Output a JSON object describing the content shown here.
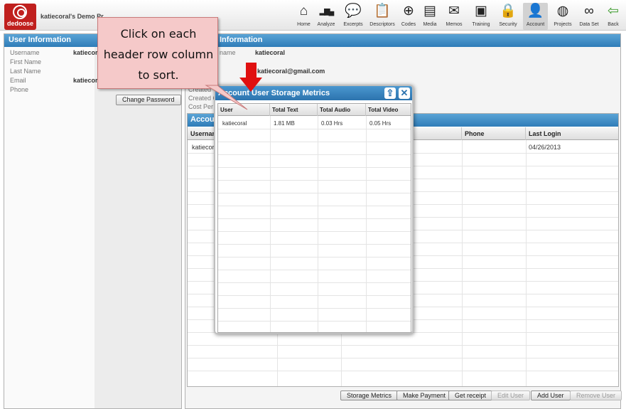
{
  "app": {
    "logo_text": "dedoose",
    "project_name": "katiecoral's Demo Pr"
  },
  "nav": [
    {
      "label": "Home",
      "icon": "home-icon",
      "glyph": "⌂"
    },
    {
      "label": "Analyze",
      "icon": "bar-chart-icon",
      "glyph": "▂▆▄"
    },
    {
      "label": "Excerpts",
      "icon": "speech-bubble-icon",
      "glyph": "💬"
    },
    {
      "label": "Descriptors",
      "icon": "clipboard-icon",
      "glyph": "📋"
    },
    {
      "label": "Codes",
      "icon": "plus-circle-icon",
      "glyph": "⊕"
    },
    {
      "label": "Media",
      "icon": "document-icon",
      "glyph": "▤"
    },
    {
      "label": "Memos",
      "icon": "scroll-icon",
      "glyph": "✉"
    },
    {
      "label": "Training",
      "icon": "training-icon",
      "glyph": "▣"
    },
    {
      "label": "Security",
      "icon": "lock-icon",
      "glyph": "🔒"
    },
    {
      "label": "Account",
      "icon": "person-icon",
      "glyph": "👤"
    },
    {
      "label": "Projects",
      "icon": "globe-icon",
      "glyph": "◍"
    },
    {
      "label": "Data Set",
      "icon": "binoculars-icon",
      "glyph": "∞"
    },
    {
      "label": "Back",
      "icon": "back-arrow-icon",
      "glyph": "⇦"
    }
  ],
  "left_panel": {
    "title": "User Information",
    "fields": [
      {
        "label": "Username",
        "value": "katiecoral"
      },
      {
        "label": "First Name",
        "value": ""
      },
      {
        "label": "Last Name",
        "value": ""
      },
      {
        "label": "Email",
        "value": "katiecor"
      },
      {
        "label": "Phone",
        "value": ""
      }
    ],
    "change_password_label": "Change Password"
  },
  "right_panel": {
    "title": "Information",
    "username_label": "name",
    "username_value": "katiecoral",
    "email_value": "katiecoral@gmail.com",
    "created_label": "Created",
    "created_on_label": "Created C",
    "cost_label": "Cost Per U",
    "users_title": "Accou",
    "columns": [
      "Usernam",
      "Phone",
      "Last Login"
    ],
    "rows": [
      {
        "username": "katiecor",
        "phone": "",
        "last_login": "04/26/2013"
      }
    ],
    "buttons": {
      "storage_metrics": "Storage Metrics",
      "make_payment": "Make Payment",
      "get_receipt": "Get receipt",
      "edit_user": "Edit User",
      "add_user": "Add User",
      "remove_user": "Remove User"
    }
  },
  "popup": {
    "title": "Account User Storage Metrics",
    "columns": [
      "User",
      "Total Text",
      "Total Audio",
      "Total Video"
    ],
    "rows": [
      {
        "user": "katiecoral",
        "total_text": "1.81 MB",
        "total_audio": "0.03 Hrs",
        "total_video": "0.05 Hrs"
      }
    ]
  },
  "callout": {
    "text": "Click on each header row column to sort."
  },
  "colors": {
    "header_blue": "#2f7cb8",
    "callout_fill": "#f5c9c9",
    "arrow_red": "#e01010",
    "logo_red": "#c0201e"
  }
}
